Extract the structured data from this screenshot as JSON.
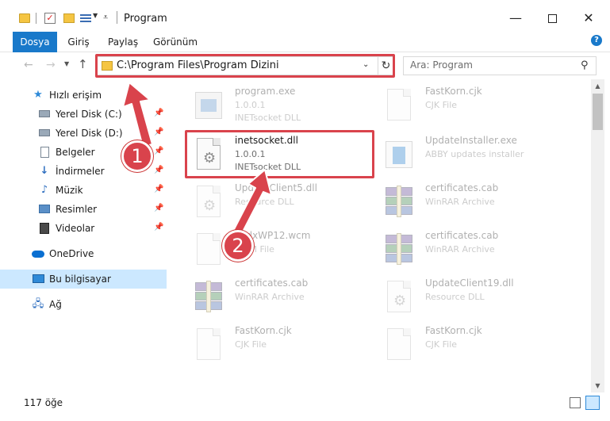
{
  "window": {
    "title": "Program"
  },
  "ribbon": {
    "tabs": [
      "Dosya",
      "Giriş",
      "Paylaş",
      "Görünüm"
    ]
  },
  "address": {
    "path": "C:\\Program Files\\Program Dizini"
  },
  "search": {
    "placeholder": "Ara: Program"
  },
  "sidebar": {
    "items": [
      {
        "label": "Hızlı erişim",
        "icon": "star-icon"
      },
      {
        "label": "Yerel Disk (C:)",
        "icon": "drive-icon"
      },
      {
        "label": "Yerel Disk (D:)",
        "icon": "drive-icon"
      },
      {
        "label": "Belgeler",
        "icon": "documents-icon"
      },
      {
        "label": "İndirmeler",
        "icon": "download-icon"
      },
      {
        "label": "Müzik",
        "icon": "music-icon"
      },
      {
        "label": "Resimler",
        "icon": "pictures-icon"
      },
      {
        "label": "Videolar",
        "icon": "videos-icon"
      },
      {
        "label": "OneDrive",
        "icon": "cloud-icon"
      },
      {
        "label": "Bu bilgisayar",
        "icon": "computer-icon"
      },
      {
        "label": "Ağ",
        "icon": "network-icon"
      }
    ]
  },
  "files": [
    {
      "name": "program.exe",
      "meta1": "1.0.0.1",
      "meta2": "INETsocket DLL",
      "icon": "exe-icon"
    },
    {
      "name": "FastKorn.cjk",
      "meta1": "CJK File",
      "meta2": "",
      "icon": "page-icon"
    },
    {
      "name": "inetsocket.dll",
      "meta1": "1.0.0.1",
      "meta2": "INETsocket DLL",
      "icon": "dll-icon"
    },
    {
      "name": "UpdateInstaller.exe",
      "meta1": "ABBY updates installer",
      "meta2": "",
      "icon": "installer-icon"
    },
    {
      "name": "UpdateClient5.dll",
      "meta1": "Resource DLL",
      "meta2": "",
      "icon": "dll-icon"
    },
    {
      "name": "certificates.cab",
      "meta1": "WinRAR Archive",
      "meta2": "",
      "icon": "rar-icon"
    },
    {
      "name": "ForlxWP12.wcm",
      "meta1": "WCM File",
      "meta2": "",
      "icon": "page-icon"
    },
    {
      "name": "certificates.cab",
      "meta1": "WinRAR Archive",
      "meta2": "",
      "icon": "rar-icon"
    },
    {
      "name": "certificates.cab",
      "meta1": "WinRAR Archive",
      "meta2": "",
      "icon": "rar-icon"
    },
    {
      "name": "UpdateClient19.dll",
      "meta1": "Resource DLL",
      "meta2": "",
      "icon": "dll-icon"
    },
    {
      "name": "FastKorn.cjk",
      "meta1": "CJK File",
      "meta2": "",
      "icon": "page-icon"
    },
    {
      "name": "FastKorn.cjk",
      "meta1": "CJK File",
      "meta2": "",
      "icon": "page-icon"
    }
  ],
  "status": {
    "count": "117 öğe"
  },
  "annotations": {
    "step1": "1",
    "step2": "2"
  },
  "colors": {
    "accent": "#1979ca",
    "highlight": "#d9434c",
    "selected": "#cce8ff"
  }
}
